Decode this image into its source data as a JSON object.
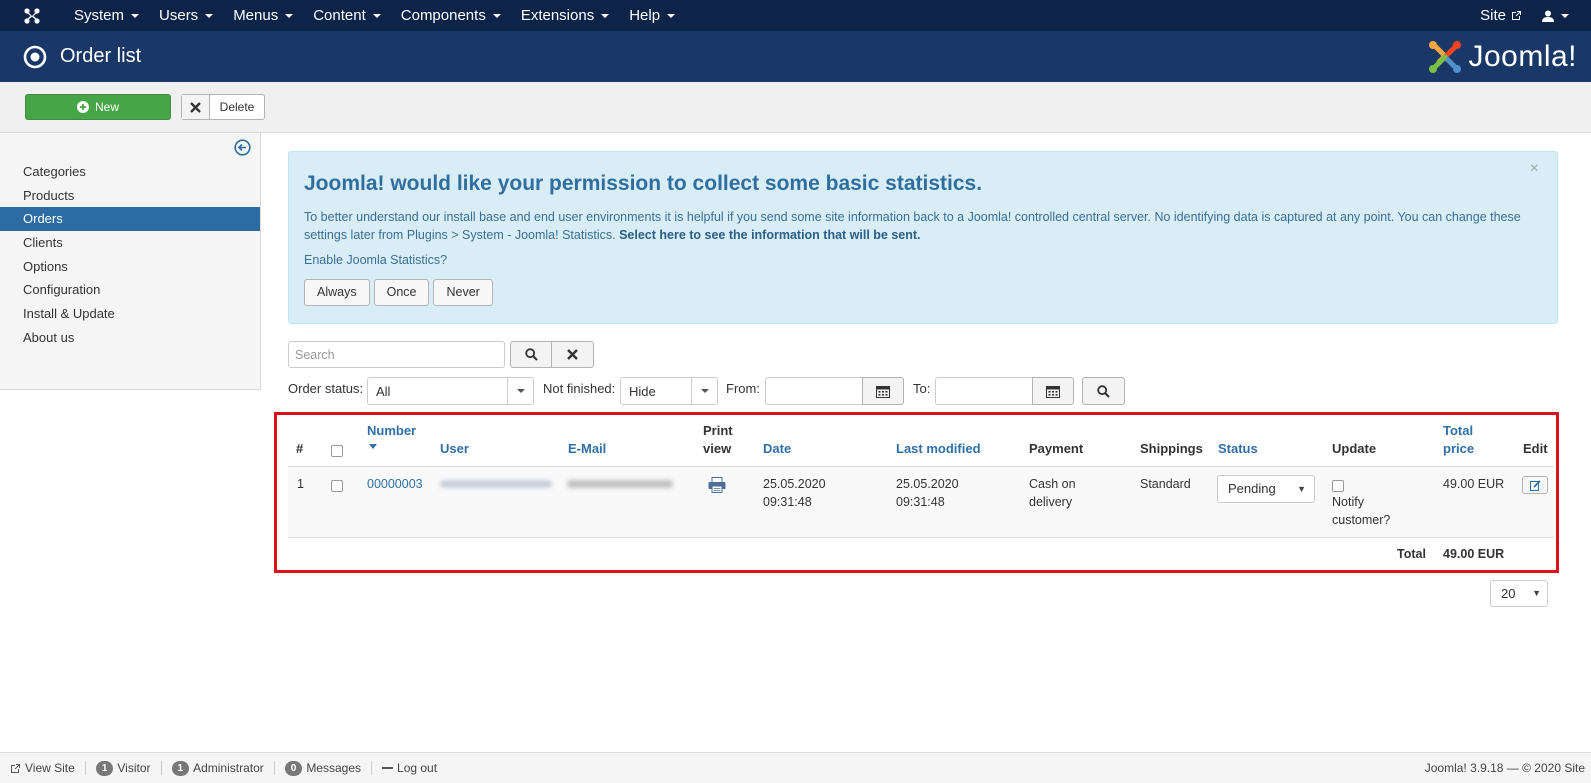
{
  "navbar": {
    "menus": [
      "System",
      "Users",
      "Menus",
      "Content",
      "Components",
      "Extensions",
      "Help"
    ],
    "site_label": "Site"
  },
  "header": {
    "title": "Order list",
    "logo_text": "Joomla!"
  },
  "toolbar": {
    "new_label": "New",
    "delete_label": "Delete"
  },
  "sidebar": {
    "items": [
      {
        "label": "Categories"
      },
      {
        "label": "Products"
      },
      {
        "label": "Orders",
        "active": true
      },
      {
        "label": "Clients"
      },
      {
        "label": "Options"
      },
      {
        "label": "Configuration"
      },
      {
        "label": "Install & Update"
      },
      {
        "label": "About us"
      }
    ]
  },
  "alert": {
    "title": "Joomla! would like your permission to collect some basic statistics.",
    "description": "To better understand our install base and end user environments it is helpful if you send some site information back to a Joomla! controlled central server. No identifying data is captured at any point. You can change these settings later from Plugins > System - Joomla! Statistics.",
    "link_text": "Select here to see the information that will be sent.",
    "question": "Enable Joomla Statistics?",
    "buttons": [
      "Always",
      "Once",
      "Never"
    ],
    "close": "×"
  },
  "search": {
    "placeholder": "Search"
  },
  "filters": {
    "order_status_label": "Order status:",
    "order_status_value": "All",
    "not_finished_label": "Not finished:",
    "not_finished_value": "Hide",
    "from_label": "From:",
    "to_label": "To:"
  },
  "table": {
    "headers": {
      "num": "#",
      "number": "Number",
      "user": "User",
      "email": "E-Mail",
      "print_view_1": "Print",
      "print_view_2": "view",
      "date": "Date",
      "last_modified": "Last modified",
      "payment": "Payment",
      "shippings": "Shippings",
      "status": "Status",
      "update": "Update",
      "total_price_1": "Total",
      "total_price_2": "price",
      "edit": "Edit"
    },
    "rows": [
      {
        "num": "1",
        "number": "00000003",
        "date_1": "25.05.2020",
        "date_2": "09:31:48",
        "modified_1": "25.05.2020",
        "modified_2": "09:31:48",
        "payment_1": "Cash on",
        "payment_2": "delivery",
        "shipping": "Standard",
        "status": "Pending",
        "notify_1": "Notify",
        "notify_2": "customer?",
        "total": "49.00 EUR"
      }
    ],
    "footer_label": "Total",
    "footer_total": "49.00 EUR"
  },
  "pagination": {
    "limit": "20"
  },
  "statusbar": {
    "view_site": "View Site",
    "visitor_count": "1",
    "visitor_label": "Visitor",
    "admin_count": "1",
    "admin_label": "Administrator",
    "messages_count": "0",
    "messages_label": "Messages",
    "logout": "Log out",
    "version": "Joomla! 3.9.18  —  © 2020 Site"
  },
  "colors": {
    "navbar": "#0e2348",
    "header": "#1a3867",
    "active": "#2d6ca2",
    "new_button": "#46a546",
    "highlight_border": "#d9121a"
  }
}
